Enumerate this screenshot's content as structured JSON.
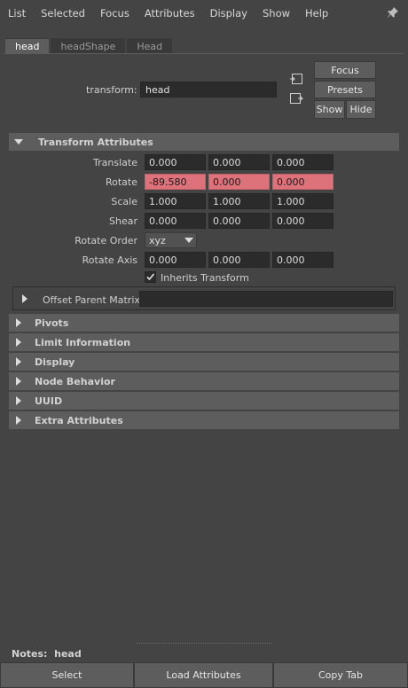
{
  "menu": [
    "List",
    "Selected",
    "Focus",
    "Attributes",
    "Display",
    "Show",
    "Help"
  ],
  "tabs": [
    {
      "label": "head",
      "active": true
    },
    {
      "label": "headShape",
      "active": false
    },
    {
      "label": "Head",
      "active": false
    }
  ],
  "transform": {
    "label": "transform:",
    "value": "head"
  },
  "buttons": {
    "focus": "Focus",
    "presets": "Presets",
    "show": "Show",
    "hide": "Hide"
  },
  "transform_attributes": {
    "title": "Transform Attributes",
    "translate": {
      "label": "Translate",
      "values": [
        "0.000",
        "0.000",
        "0.000"
      ]
    },
    "rotate": {
      "label": "Rotate",
      "values": [
        "-89.580",
        "0.000",
        "0.000"
      ]
    },
    "scale": {
      "label": "Scale",
      "values": [
        "1.000",
        "1.000",
        "1.000"
      ]
    },
    "shear": {
      "label": "Shear",
      "values": [
        "0.000",
        "0.000",
        "0.000"
      ]
    },
    "rotate_order": {
      "label": "Rotate Order",
      "value": "xyz"
    },
    "rotate_axis": {
      "label": "Rotate Axis",
      "values": [
        "0.000",
        "0.000",
        "0.000"
      ]
    },
    "inherits_transform": {
      "label": "Inherits Transform",
      "checked": true
    },
    "offset_parent_matrix": {
      "label": "Offset Parent Matrix"
    }
  },
  "sections": [
    "Pivots",
    "Limit Information",
    "Display",
    "Node Behavior",
    "UUID",
    "Extra Attributes"
  ],
  "notes": {
    "label": "Notes:",
    "value": "head"
  },
  "bottom_buttons": {
    "select": "Select",
    "load": "Load Attributes",
    "copy": "Copy Tab"
  },
  "colors": {
    "keyed": "#dd727a",
    "panel": "#444444",
    "header": "#5d5d5d",
    "field": "#2b2b2b"
  }
}
